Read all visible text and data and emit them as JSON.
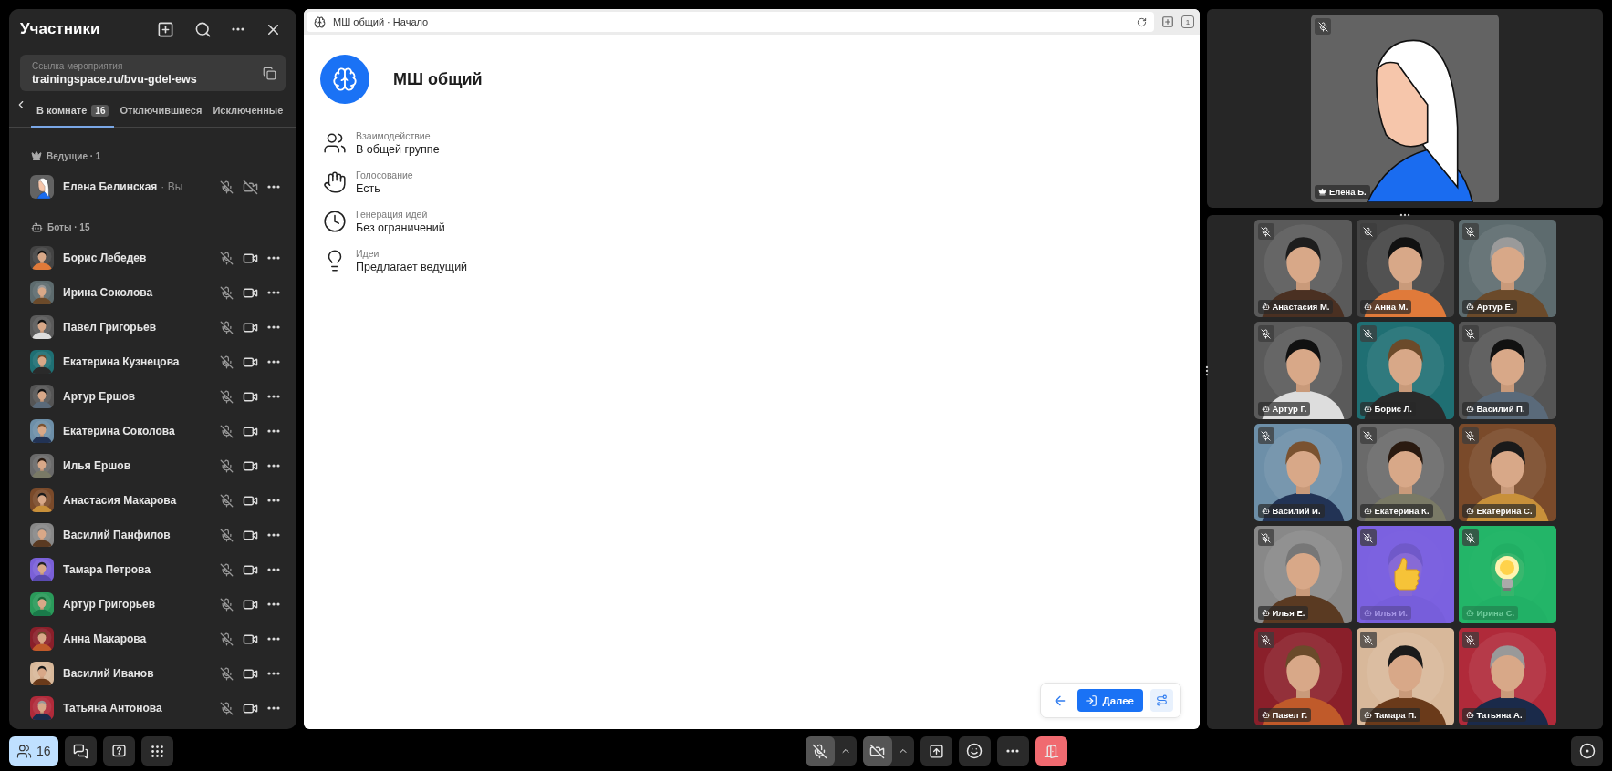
{
  "participants_panel": {
    "title": "Участники",
    "event_link": {
      "label": "Ссылка мероприятия",
      "url": "trainingspace.ru/bvu-gdel-ews"
    },
    "tabs": [
      {
        "label": "В комнате",
        "count": "16",
        "selected": true
      },
      {
        "label": "Отключившиеся",
        "selected": false
      },
      {
        "label": "Исключенные",
        "selected": false
      }
    ],
    "groups": [
      {
        "kind": "hosts",
        "title": "Ведущие · 1",
        "members": [
          {
            "name": "Елена Белинская",
            "suffix": "· Вы",
            "mic_muted": true,
            "camera_on": false
          }
        ]
      },
      {
        "kind": "bots",
        "title": "Боты · 15",
        "members": [
          {
            "name": "Борис Лебедев",
            "mic_muted": true,
            "camera_on": true
          },
          {
            "name": "Ирина Соколова",
            "mic_muted": true,
            "camera_on": true
          },
          {
            "name": "Павел Григорьев",
            "mic_muted": true,
            "camera_on": true
          },
          {
            "name": "Екатерина Кузнецова",
            "mic_muted": true,
            "camera_on": true
          },
          {
            "name": "Артур Ершов",
            "mic_muted": true,
            "camera_on": true
          },
          {
            "name": "Екатерина Соколова",
            "mic_muted": true,
            "camera_on": true
          },
          {
            "name": "Илья Ершов",
            "mic_muted": true,
            "camera_on": true
          },
          {
            "name": "Анастасия Макарова",
            "mic_muted": true,
            "camera_on": true
          },
          {
            "name": "Василий Панфилов",
            "mic_muted": true,
            "camera_on": true
          },
          {
            "name": "Тамара Петрова",
            "mic_muted": true,
            "camera_on": true
          },
          {
            "name": "Артур Григорьев",
            "mic_muted": true,
            "camera_on": true
          },
          {
            "name": "Анна Макарова",
            "mic_muted": true,
            "camera_on": true
          },
          {
            "name": "Василий Иванов",
            "mic_muted": true,
            "camera_on": true
          },
          {
            "name": "Татьяна Антонова",
            "mic_muted": true,
            "camera_on": true
          }
        ]
      }
    ]
  },
  "document": {
    "tab_title": "МШ общий · Начало",
    "page_count": "1",
    "title": "МШ общий",
    "properties": [
      {
        "kind": "people",
        "label": "Взаимодействие",
        "value": "В общей группе"
      },
      {
        "kind": "hand",
        "label": "Голосование",
        "value": "Есть"
      },
      {
        "kind": "clock",
        "label": "Генерация идей",
        "value": "Без ограничений"
      },
      {
        "kind": "bulb",
        "label": "Идеи",
        "value": "Предлагает ведущий"
      }
    ],
    "next_button": "Далее"
  },
  "stage": {
    "presenter": {
      "name": "Елена Б.",
      "mic_muted": true
    },
    "tiles": [
      {
        "kind": "video",
        "name": "Анастасия М.",
        "mic_muted": true
      },
      {
        "kind": "video",
        "name": "Анна М.",
        "mic_muted": true
      },
      {
        "kind": "video",
        "name": "Артур Е.",
        "mic_muted": true
      },
      {
        "kind": "video",
        "name": "Артур Г.",
        "mic_muted": true
      },
      {
        "kind": "video",
        "name": "Борис Л.",
        "mic_muted": true
      },
      {
        "kind": "video",
        "name": "Василий П.",
        "mic_muted": true
      },
      {
        "kind": "video",
        "name": "Василий И.",
        "mic_muted": true
      },
      {
        "kind": "video",
        "name": "Екатерина К.",
        "mic_muted": true
      },
      {
        "kind": "video",
        "name": "Екатерина С.",
        "mic_muted": true
      },
      {
        "kind": "video",
        "name": "Илья Е.",
        "mic_muted": true
      },
      {
        "kind": "like",
        "name": "Илья И.",
        "mic_muted": true
      },
      {
        "kind": "idea",
        "name": "Ирина С.",
        "mic_muted": true
      },
      {
        "kind": "video",
        "name": "Павел Г.",
        "mic_muted": true
      },
      {
        "kind": "video",
        "name": "Тамара П.",
        "mic_muted": true
      },
      {
        "kind": "video",
        "name": "Татьяна А.",
        "mic_muted": true
      }
    ]
  },
  "toolbar": {
    "participants_count": "16",
    "participants_open": true,
    "mic_muted": true,
    "camera_on": false
  }
}
